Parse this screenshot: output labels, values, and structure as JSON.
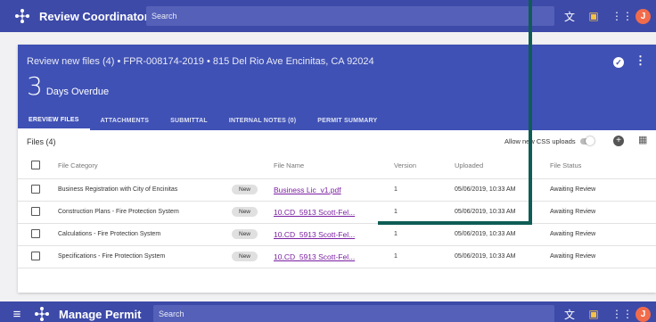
{
  "topbar": {
    "title": "Review Coordinator",
    "search_placeholder": "Search",
    "translate_icon": "translate-icon",
    "notifications_icon": "notification-badge-icon",
    "apps_icon": "apps-grid-icon",
    "avatar_initial": "J"
  },
  "review": {
    "title": "Review new files (4) • FPR-008174-2019 • 815 Del Rio Ave Encinitas, CA 92024",
    "overdue_number": "3",
    "overdue_label": "Days Overdue"
  },
  "tabs": [
    {
      "label": "EREVIEW FILES",
      "active": true
    },
    {
      "label": "ATTACHMENTS",
      "active": false
    },
    {
      "label": "SUBMITTAL",
      "active": false
    },
    {
      "label": "INTERNAL NOTES (0)",
      "active": false
    },
    {
      "label": "PERMIT SUMMARY",
      "active": false
    }
  ],
  "files": {
    "count_label": "Files (4)",
    "csv_toggle_label": "Allow new CSS uploads",
    "columns": [
      "File Category",
      "File Name",
      "Version",
      "Uploaded",
      "File Status"
    ],
    "rows": [
      {
        "category": "Business Registration with City of Encinitas",
        "badge": "New",
        "name": "Business Lic_v1.pdf",
        "version": "1",
        "uploaded": "05/06/2019, 10:33 AM",
        "status": "Awaiting Review"
      },
      {
        "category": "Construction Plans - Fire Protection System",
        "badge": "New",
        "name": "10.CD_5913 Scott-Fel...",
        "version": "1",
        "uploaded": "05/06/2019, 10:33 AM",
        "status": "Awaiting Review"
      },
      {
        "category": "Calculations - Fire Protection System",
        "badge": "New",
        "name": "10.CD_5913 Scott-Fel...",
        "version": "1",
        "uploaded": "05/06/2019, 10:33 AM",
        "status": "Awaiting Review"
      },
      {
        "category": "Specifications - Fire Protection System",
        "badge": "New",
        "name": "10.CD_5913 Scott-Fel...",
        "version": "1",
        "uploaded": "05/06/2019, 10:33 AM",
        "status": "Awaiting Review"
      }
    ]
  },
  "bottombar": {
    "title": "Manage Permit",
    "search_placeholder": "Search",
    "avatar_initial": "J"
  },
  "colors": {
    "appbar": "#3d4aa8",
    "header": "#3f51b5",
    "link": "#7b1fa2",
    "annotation": "#0f5d55"
  }
}
